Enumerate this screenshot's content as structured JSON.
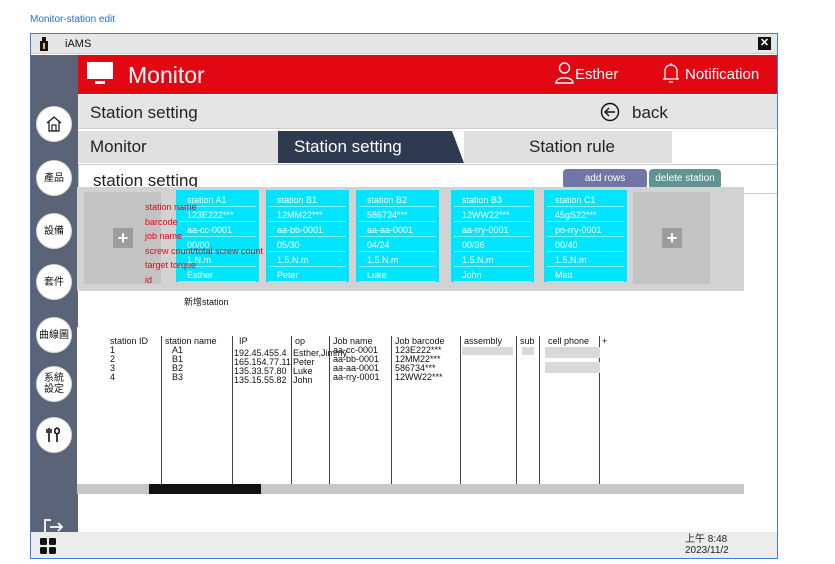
{
  "page_caption": "Monitor-station edit",
  "window": {
    "title": "iAMS",
    "close": "✕"
  },
  "header": {
    "title": "Monitor",
    "user": "Esther",
    "notification": "Notification"
  },
  "crumb": {
    "title": "Station setting",
    "back": "back"
  },
  "tabs": [
    {
      "label": "Monitor",
      "active": false
    },
    {
      "label": "Station setting",
      "active": true
    },
    {
      "label": "Station rule",
      "active": false
    }
  ],
  "section": {
    "title": "station setting",
    "add_rows": "add rows",
    "delete_station": "delete station"
  },
  "sidebar": [
    {
      "label": "",
      "icon": "home-icon"
    },
    {
      "label": "產品",
      "icon": ""
    },
    {
      "label": "設備",
      "icon": ""
    },
    {
      "label": "套件",
      "icon": ""
    },
    {
      "label": "曲線圖",
      "icon": ""
    },
    {
      "label": "系統\n設定",
      "icon": ""
    },
    {
      "label": "",
      "icon": "tools-icon"
    }
  ],
  "legend": [
    "station name",
    "barcode",
    "job name",
    "screw count/total screw count",
    "target torque",
    "id"
  ],
  "stations": [
    [
      "station A1",
      "123E222***",
      "aa-cc-0001",
      "00/00",
      "1.N.m",
      "Esther"
    ],
    [
      "station B1",
      "12MM22***",
      "aa-bb-0001",
      "05/30",
      "1.5.N.m",
      "Peter"
    ],
    [
      "station B2",
      "586734***",
      "aa-aa-0001",
      "04/24",
      "1.5.N.m",
      "Luke"
    ],
    [
      "station B3",
      "12WW22***",
      "aa-rry-0001",
      "00/36",
      "1.5.N.m",
      "John"
    ],
    [
      "station C1",
      "45gS22***",
      "po-rry-0001",
      "00/40",
      "1.5.N.m",
      "Matt"
    ]
  ],
  "add_station_label": "新增station",
  "table": {
    "headers": [
      "station ID",
      "station name",
      "IP",
      "op",
      "Job name",
      "Job barcode",
      "assembly",
      "sub",
      "cell phone",
      "+"
    ],
    "rows": [
      [
        "1",
        "A1",
        "192.45.455.4",
        "Esther,Jimmy",
        "aa-cc-0001",
        "123E222***"
      ],
      [
        "2",
        "B1",
        "165.154.77.11",
        "Peter",
        "aa-bb-0001",
        "12MM22***"
      ],
      [
        "3",
        "B2",
        "135.33.57.80",
        "Luke",
        "aa-aa-0001",
        "586734***"
      ],
      [
        "4",
        "B3",
        "135.15.55.82",
        "John",
        "aa-rry-0001",
        "12WW22***"
      ]
    ]
  },
  "clock": {
    "time": "上午 8:48",
    "date": "2023/11/2"
  },
  "colors": {
    "header_red": "#e30713",
    "sidebar": "#5b6376",
    "station_card": "#00e5ff",
    "active_tab": "#2e3a4f"
  }
}
